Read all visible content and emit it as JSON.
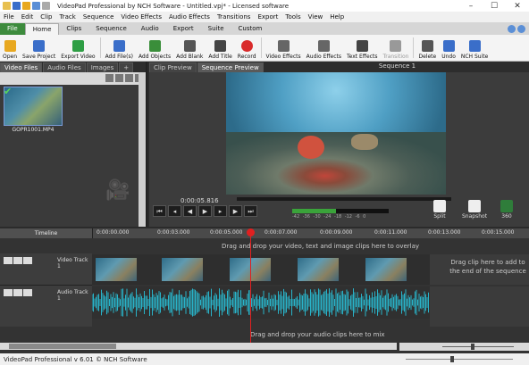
{
  "window": {
    "title": "VideoPad Professional by NCH Software - Untitled.vpj* - Licensed software",
    "controls": [
      "–",
      "☐",
      "✕"
    ]
  },
  "menu": [
    "File",
    "Edit",
    "Clip",
    "Track",
    "Sequence",
    "Video Effects",
    "Audio Effects",
    "Transitions",
    "Export",
    "Tools",
    "View",
    "Help"
  ],
  "ribbon_tabs": [
    "File",
    "Home",
    "Clips",
    "Sequence",
    "Audio",
    "Export",
    "Suite",
    "Custom"
  ],
  "toolbar": [
    {
      "label": "Open",
      "icon": "open-icon",
      "color": "#e8a820"
    },
    {
      "label": "Save Project",
      "icon": "save-icon",
      "color": "#3a6ec9"
    },
    {
      "label": "Export Video",
      "icon": "export-video-icon",
      "color": "#2e9e44"
    },
    {
      "label": "Add File(s)",
      "icon": "add-file-icon",
      "color": "#3a6ec9"
    },
    {
      "label": "Add Objects",
      "icon": "add-objects-icon",
      "color": "#3a8e3a"
    },
    {
      "label": "Add Blank",
      "icon": "add-blank-icon",
      "color": "#555"
    },
    {
      "label": "Add Title",
      "icon": "add-title-icon",
      "color": "#444"
    },
    {
      "label": "Record",
      "icon": "record-icon",
      "color": "#d92b2b"
    },
    {
      "label": "Video Effects",
      "icon": "video-effects-icon",
      "color": "#666"
    },
    {
      "label": "Audio Effects",
      "icon": "audio-effects-icon",
      "color": "#666"
    },
    {
      "label": "Text Effects",
      "icon": "text-effects-icon",
      "color": "#444"
    },
    {
      "label": "Transition",
      "icon": "transition-icon",
      "color": "#999"
    },
    {
      "label": "Delete",
      "icon": "delete-icon",
      "color": "#555"
    },
    {
      "label": "Undo",
      "icon": "undo-icon",
      "color": "#3a6ec9"
    },
    {
      "label": "NCH Suite",
      "icon": "nch-suite-icon",
      "color": "#3a6ec9"
    }
  ],
  "bin_tabs": [
    "Video Files",
    "Audio Files",
    "Images",
    "+"
  ],
  "clip_name": "GOPR1001.MP4",
  "preview_tabs": [
    "Clip Preview",
    "Sequence Preview"
  ],
  "sequence_title": "Sequence 1",
  "timecode": "0:00:05.816",
  "meter_labels": "-42 -36 -30 -24 -18 -12 -6 0",
  "meter_level": 0.45,
  "preview_buttons": [
    {
      "label": "Split"
    },
    {
      "label": "Snapshot"
    },
    {
      "label": "360"
    }
  ],
  "timeline": {
    "label": "Timeline",
    "ruler": [
      "0:00:00.000",
      "0:00:03.000",
      "0:00:05.000",
      "0:00:07.000",
      "0:00:09.000",
      "0:00:11.000",
      "0:00:13.000",
      "0:00:15.000"
    ],
    "overlay_hint": "Drag and drop your video, text and image clips here to overlay",
    "video_track": "Video Track 1",
    "audio_track": "Audio Track 1",
    "video_end_hint": "Drag clip here to add to the end of the sequence",
    "audio_hint": "Drag and drop your audio clips here to mix"
  },
  "status": "VideoPad Professional v 6.01 © NCH Software",
  "accent": "#e02020"
}
